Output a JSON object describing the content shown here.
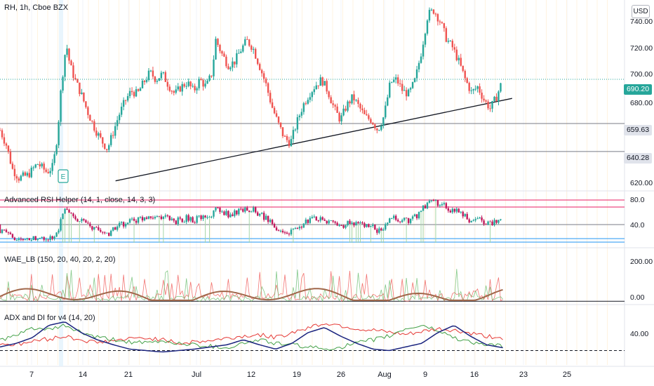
{
  "header": {
    "title": "RH, 1h, Cboe BZX",
    "currency": "USD"
  },
  "panels": {
    "rsi": "Advanced RSI Helper (14, 1, close, 14, 3, 3)",
    "wae": "WAE_LB (150, 20, 40, 20, 2, 20)",
    "adx": "ADX and DI for v4 (14, 20)"
  },
  "earnings_marker": "E",
  "price_tags": {
    "last": "690.20",
    "level_1": "659.63",
    "level_2": "640.28"
  },
  "colors": {
    "up": "#26a69a",
    "down": "#ef5350",
    "grid": "#f0f3fa",
    "axis": "#e0e3eb"
  },
  "chart_data": [
    {
      "type": "candlestick",
      "ylim": [
        615,
        745
      ],
      "yticks": [
        "740.00",
        "720.00",
        "700.00",
        "680.00",
        "620.00"
      ],
      "xtick_labels": [
        "7",
        "14",
        "21",
        "Jul",
        "12",
        "19",
        "26",
        "Aug",
        "9",
        "16",
        "23",
        "25"
      ],
      "last_price": 690.2,
      "horizontal_levels": [
        659.63,
        640.28
      ],
      "trendline": [
        {
          "t": 0.185,
          "price": 620
        },
        {
          "t": 0.82,
          "price": 677
        }
      ],
      "path": [
        [
          0,
          655
        ],
        [
          0.01,
          645
        ],
        [
          0.02,
          628
        ],
        [
          0.03,
          622
        ],
        [
          0.045,
          624
        ],
        [
          0.06,
          632
        ],
        [
          0.075,
          626
        ],
        [
          0.085,
          630
        ],
        [
          0.092,
          652
        ],
        [
          0.098,
          685
        ],
        [
          0.106,
          715
        ],
        [
          0.112,
          700
        ],
        [
          0.12,
          690
        ],
        [
          0.13,
          680
        ],
        [
          0.14,
          668
        ],
        [
          0.152,
          656
        ],
        [
          0.162,
          648
        ],
        [
          0.172,
          642
        ],
        [
          0.18,
          652
        ],
        [
          0.19,
          665
        ],
        [
          0.2,
          675
        ],
        [
          0.21,
          682
        ],
        [
          0.22,
          680
        ],
        [
          0.23,
          688
        ],
        [
          0.24,
          695
        ],
        [
          0.25,
          690
        ],
        [
          0.26,
          694
        ],
        [
          0.27,
          686
        ],
        [
          0.28,
          680
        ],
        [
          0.29,
          685
        ],
        [
          0.3,
          688
        ],
        [
          0.31,
          682
        ],
        [
          0.32,
          690
        ],
        [
          0.33,
          685
        ],
        [
          0.34,
          695
        ],
        [
          0.345,
          718
        ],
        [
          0.355,
          708
        ],
        [
          0.365,
          700
        ],
        [
          0.375,
          702
        ],
        [
          0.385,
          710
        ],
        [
          0.395,
          717
        ],
        [
          0.405,
          712
        ],
        [
          0.415,
          700
        ],
        [
          0.425,
          688
        ],
        [
          0.435,
          672
        ],
        [
          0.445,
          660
        ],
        [
          0.455,
          650
        ],
        [
          0.465,
          646
        ],
        [
          0.475,
          660
        ],
        [
          0.485,
          672
        ],
        [
          0.495,
          680
        ],
        [
          0.505,
          686
        ],
        [
          0.515,
          690
        ],
        [
          0.525,
          682
        ],
        [
          0.535,
          670
        ],
        [
          0.545,
          662
        ],
        [
          0.555,
          672
        ],
        [
          0.565,
          678
        ],
        [
          0.575,
          671
        ],
        [
          0.585,
          664
        ],
        [
          0.595,
          662
        ],
        [
          0.605,
          655
        ],
        [
          0.615,
          665
        ],
        [
          0.625,
          688
        ],
        [
          0.635,
          690
        ],
        [
          0.645,
          682
        ],
        [
          0.655,
          680
        ],
        [
          0.665,
          690
        ],
        [
          0.675,
          710
        ],
        [
          0.685,
          735
        ],
        [
          0.695,
          738
        ],
        [
          0.705,
          730
        ],
        [
          0.715,
          718
        ],
        [
          0.725,
          712
        ],
        [
          0.735,
          702
        ],
        [
          0.745,
          690
        ],
        [
          0.755,
          681
        ],
        [
          0.765,
          685
        ],
        [
          0.775,
          676
        ],
        [
          0.785,
          670
        ],
        [
          0.795,
          678
        ],
        [
          0.805,
          690
        ]
      ]
    },
    {
      "type": "line",
      "title": "Advanced RSI Helper (14, 1, close, 14, 3, 3)",
      "ylim": [
        20,
        95
      ],
      "yticks": [
        "80.0",
        "40.0"
      ],
      "levels": [
        85,
        75,
        50,
        30,
        25
      ]
    },
    {
      "type": "area",
      "title": "WAE_LB (150, 20, 40, 20, 2, 20)",
      "ylim": [
        -10,
        270
      ],
      "yticks": [
        "200.00",
        "0.00"
      ]
    },
    {
      "type": "line",
      "title": "ADX and DI for v4 (14, 20)",
      "ylim": [
        0,
        80
      ],
      "yticks": [
        "40.00"
      ],
      "threshold": 20,
      "series": [
        {
          "color": "#e53935",
          "values": [
            30,
            28,
            33,
            36,
            40,
            35,
            31,
            34,
            36,
            38,
            35,
            30,
            32,
            34,
            37,
            40,
            42,
            38,
            45,
            52,
            58,
            55,
            50,
            48,
            45,
            42,
            46,
            50,
            48,
            44,
            40,
            38
          ]
        },
        {
          "color": "#43a047",
          "values": [
            35,
            40,
            52,
            48,
            55,
            45,
            38,
            35,
            32,
            30,
            33,
            30,
            28,
            26,
            24,
            30,
            35,
            30,
            28,
            25,
            22,
            25,
            30,
            35,
            40,
            50,
            55,
            48,
            38,
            32,
            28,
            26
          ]
        },
        {
          "color": "#1a237e",
          "values": [
            25,
            30,
            38,
            55,
            60,
            45,
            35,
            28,
            22,
            20,
            18,
            20,
            22,
            25,
            28,
            35,
            28,
            22,
            30,
            45,
            52,
            40,
            30,
            22,
            20,
            25,
            30,
            45,
            55,
            40,
            28,
            24
          ]
        }
      ]
    }
  ]
}
